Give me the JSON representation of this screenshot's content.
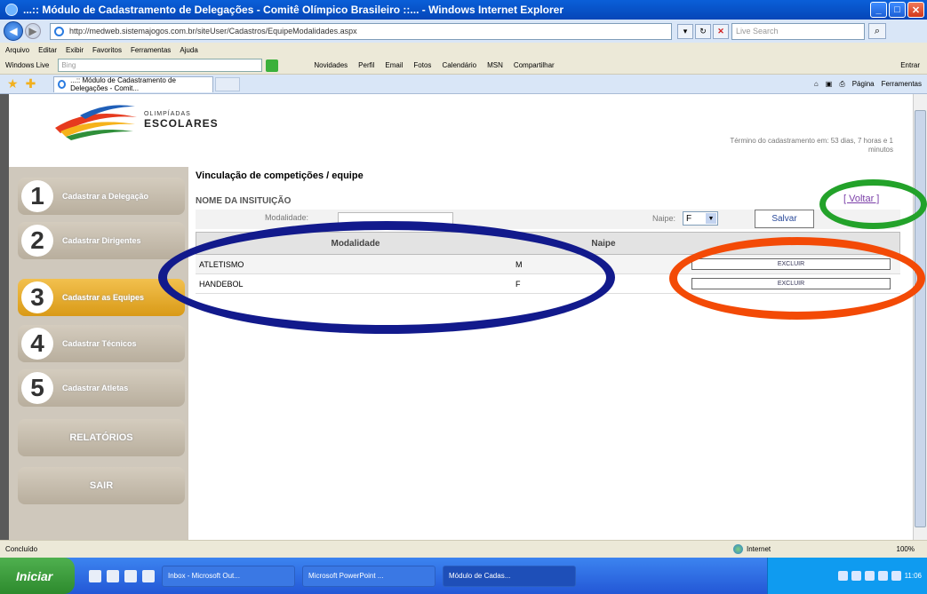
{
  "window": {
    "title": "...:: Módulo de Cadastramento de Delegações - Comitê Olímpico Brasileiro ::... - Windows Internet Explorer",
    "controls": {
      "minimize": "_",
      "maximize": "□",
      "close": "✕"
    }
  },
  "browser": {
    "url": "http://medweb.sistemajogos.com.br/siteUser/Cadastros/EquipeModalidades.aspx",
    "search_placeholder": "Live Search",
    "menu": [
      "Arquivo",
      "Editar",
      "Exibir",
      "Favoritos",
      "Ferramentas",
      "Ajuda"
    ],
    "live_toolbar": {
      "brand": "Windows Live",
      "search_placeholder": "Bing",
      "links": [
        "Novidades",
        "Perfil",
        "Email",
        "Fotos",
        "Calendário",
        "MSN",
        "Compartilhar"
      ],
      "signin": "Entrar"
    },
    "tab_title": "...:: Módulo de Cadastramento de Delegações - Comit...",
    "tab_tools": {
      "page": "Página",
      "tools": "Ferramentas"
    }
  },
  "site": {
    "logo_small": "OLIMPÍADAS",
    "logo_big": "ESCOLARES",
    "countdown": "Término do cadastramento em: 53 dias, 7 horas e 1 minutos"
  },
  "sidebar": {
    "items": [
      {
        "num": "1",
        "label": "Cadastrar a Delegação"
      },
      {
        "num": "2",
        "label": "Cadastrar Dirigentes"
      },
      {
        "num": "3",
        "label": "Cadastrar as Equipes"
      },
      {
        "num": "4",
        "label": "Cadastrar Técnicos"
      },
      {
        "num": "5",
        "label": "Cadastrar Atletas"
      }
    ],
    "reports": "RELATÓRIOS",
    "exit": "SAIR"
  },
  "main": {
    "title": "Vinculação de competições / equipe",
    "institution_label": "NOME DA INSITUIÇÃO",
    "back_link": "[ Voltar ]",
    "modalidade_label": "Modalidade:",
    "naipe_label": "Naipe:",
    "naipe_value": "F",
    "save_button": "Salvar",
    "columns": [
      "Modalidade",
      "Naipe"
    ],
    "rows": [
      {
        "modalidade": "ATLETISMO",
        "naipe": "M",
        "action": "EXCLUIR"
      },
      {
        "modalidade": "HANDEBOL",
        "naipe": "F",
        "action": "EXCLUIR"
      }
    ]
  },
  "statusbar": {
    "status": "Concluído",
    "zone": "Internet",
    "zoom": "100%"
  },
  "taskbar": {
    "start": "Iniciar",
    "tasks": [
      "Inbox - Microsoft Out...",
      "Microsoft PowerPoint ...",
      "Módulo de Cadas..."
    ],
    "clock": "11:06"
  },
  "annotation_colors": {
    "modalidades": "#121a8c",
    "excluir": "#f34a06",
    "voltar": "#23a22a"
  }
}
